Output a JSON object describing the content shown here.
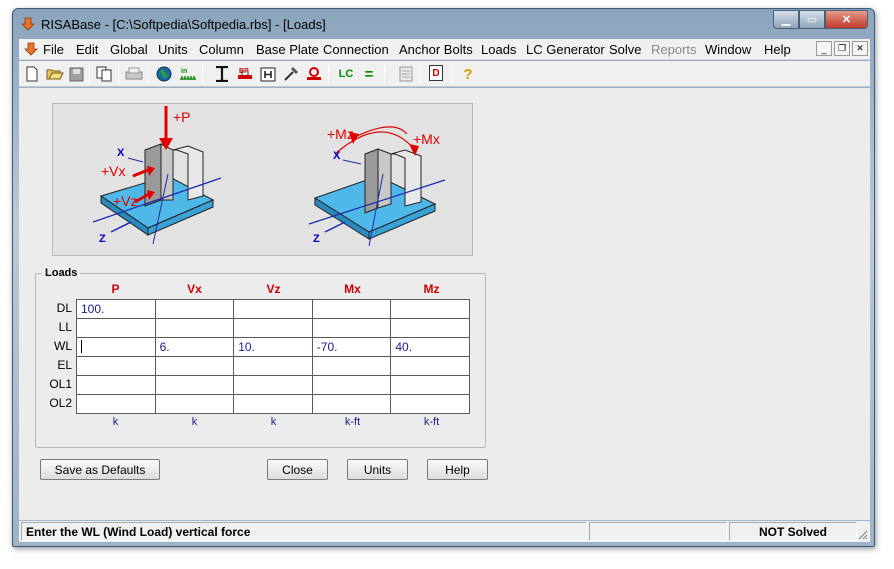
{
  "window": {
    "title": "RISABase - [C:\\Softpedia\\Softpedia.rbs] - [Loads]",
    "min_label": "▁",
    "max_label": "▭",
    "close_label": "✕"
  },
  "menu": [
    {
      "label": "File",
      "enabled": true
    },
    {
      "label": "Edit",
      "enabled": true
    },
    {
      "label": "Global",
      "enabled": true
    },
    {
      "label": "Units",
      "enabled": true
    },
    {
      "label": "Column",
      "enabled": true
    },
    {
      "label": "Base Plate",
      "enabled": true
    },
    {
      "label": "Connection",
      "enabled": true
    },
    {
      "label": "Anchor Bolts",
      "enabled": true
    },
    {
      "label": "Loads",
      "enabled": true
    },
    {
      "label": "LC Generator",
      "enabled": true
    },
    {
      "label": "Solve",
      "enabled": true
    },
    {
      "label": "Reports",
      "enabled": false
    },
    {
      "label": "Window",
      "enabled": true
    },
    {
      "label": "Help",
      "enabled": true
    }
  ],
  "toolbar_icons": [
    "new-file-icon",
    "open-folder-icon",
    "save-icon",
    "copy-icon",
    "print-icon",
    "globe-icon",
    "units-icon",
    "column-icon",
    "base-plate-icon",
    "connection-icon",
    "hammer-icon",
    "anchor-bolt-icon",
    "lc-icon",
    "equals-icon",
    "report-icon",
    "detail-icon",
    "help-icon"
  ],
  "toolbar_text": {
    "bp": "BP",
    "lc": "LC",
    "eq": "=",
    "help": "?",
    "d": "D"
  },
  "diagram": {
    "left_labels": {
      "p": "+P",
      "vx": "+Vx",
      "vz": "+Vz",
      "x": "X",
      "z": "Z"
    },
    "right_labels": {
      "mz": "+Mz",
      "mx": "+Mx",
      "x": "X",
      "z": "Z"
    },
    "red": "#e00000",
    "blue": "#0000cc",
    "plate": "#4fb8e8"
  },
  "loads": {
    "group_label": "Loads",
    "columns": [
      "P",
      "Vx",
      "Vz",
      "Mx",
      "Mz"
    ],
    "rows": [
      {
        "label": "DL",
        "values": [
          "100.",
          "",
          "",
          "",
          ""
        ]
      },
      {
        "label": "LL",
        "values": [
          "",
          "",
          "",
          "",
          ""
        ]
      },
      {
        "label": "WL",
        "values": [
          "",
          "6.",
          "10.",
          "-70.",
          "40."
        ]
      },
      {
        "label": "EL",
        "values": [
          "",
          "",
          "",
          "",
          ""
        ]
      },
      {
        "label": "OL1",
        "values": [
          "",
          "",
          "",
          "",
          ""
        ]
      },
      {
        "label": "OL2",
        "values": [
          "",
          "",
          "",
          "",
          ""
        ]
      }
    ],
    "units": [
      "k",
      "k",
      "k",
      "k-ft",
      "k-ft"
    ]
  },
  "buttons": {
    "save_defaults": "Save as Defaults",
    "close": "Close",
    "units": "Units",
    "help": "Help"
  },
  "status": {
    "message": "Enter the WL (Wind Load) vertical force",
    "solve_state": "NOT Solved"
  }
}
